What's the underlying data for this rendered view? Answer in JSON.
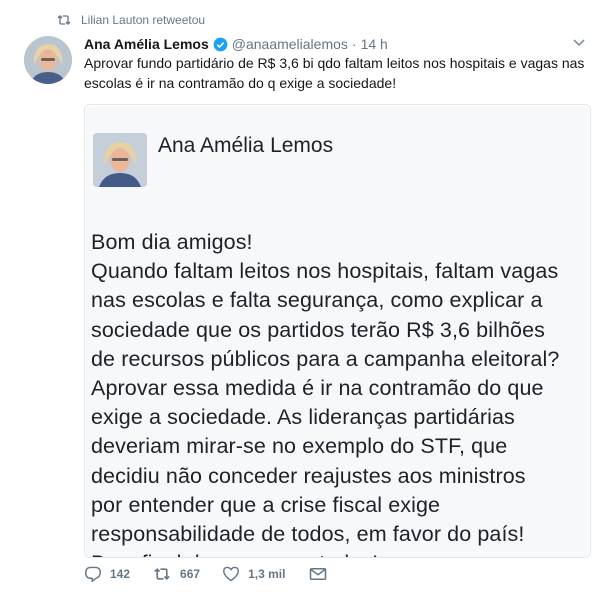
{
  "retweet": {
    "label": "Lilian Lauton retweetou"
  },
  "tweet": {
    "author_name": "Ana Amélia Lemos",
    "handle": "@anaamelialemos",
    "separator": "·",
    "time": "14 h",
    "text_line1": "Aprovar fundo partidário de R$ 3,6 bi qdo faltam leitos nos hospitais e vagas nas",
    "text_line2": "escolas é ir na contramão do q exige a sociedade!"
  },
  "card": {
    "author_name": "Ana Amélia Lemos",
    "lines": [
      "Bom dia amigos!",
      "Quando faltam leitos nos hospitais, faltam vagas",
      "nas escolas e falta segurança, como explicar a",
      "sociedade que os partidos terão R$ 3,6 bilhões",
      "de recursos públicos para a campanha eleitoral?",
      "Aprovar essa medida é ir na contramão do que",
      "exige a sociedade. As lideranças partidárias",
      "deveriam mirar-se no exemplo do STF, que",
      "decidiu não conceder reajustes aos ministros",
      "por entender que a crise fiscal exige",
      "responsabilidade de todos, em favor do país!",
      "Bom final de semana a todos!"
    ]
  },
  "actions": {
    "reply_count": "142",
    "retweet_count": "667",
    "like_count": "1,3 mil"
  },
  "colors": {
    "secondary_text": "#657786",
    "verified_blue": "#1da1f2",
    "card_border": "#e1e8ed"
  },
  "icons": [
    "retweet-icon",
    "verified-badge-icon",
    "caret-down-icon",
    "reply-icon",
    "retweet-icon",
    "heart-icon",
    "direct-message-icon"
  ]
}
